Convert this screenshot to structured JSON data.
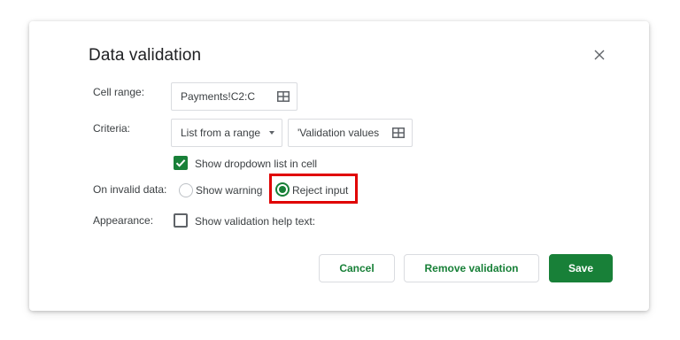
{
  "dialog": {
    "title": "Data validation",
    "close_icon": "close-icon"
  },
  "cell_range": {
    "label": "Cell range:",
    "value": "Payments!C2:C",
    "icon": "grid-select-icon"
  },
  "criteria": {
    "label": "Criteria:",
    "type_value": "List from a range",
    "range_value": "'Validation values",
    "icon": "grid-select-icon"
  },
  "dropdown_option": {
    "label": "Show dropdown list in cell",
    "checked": true
  },
  "invalid_data": {
    "label": "On invalid data:",
    "options": [
      {
        "label": "Show warning",
        "selected": false
      },
      {
        "label": "Reject input",
        "selected": true
      }
    ]
  },
  "appearance": {
    "label": "Appearance:",
    "help_text_option": "Show validation help text:",
    "checked": false
  },
  "buttons": {
    "cancel": "Cancel",
    "remove": "Remove validation",
    "save": "Save"
  },
  "colors": {
    "accent": "#188038",
    "highlight": "#e00000"
  }
}
